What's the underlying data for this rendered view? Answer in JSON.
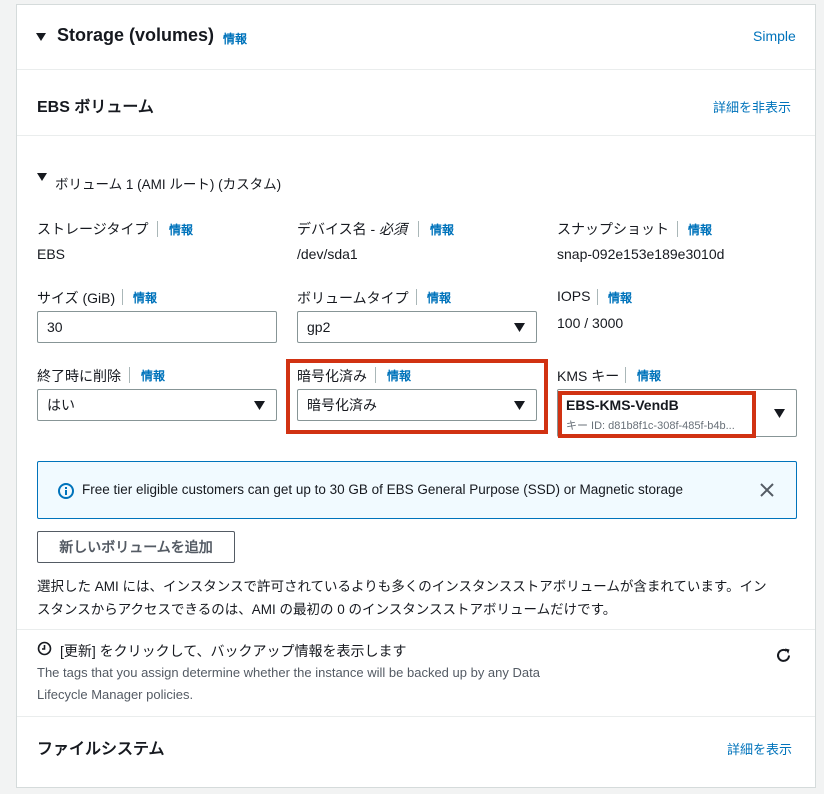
{
  "header": {
    "title": "Storage (volumes)",
    "info": "情報",
    "simple_link": "Simple"
  },
  "ebs": {
    "title": "EBS ボリューム",
    "hide_details": "詳細を非表示"
  },
  "volume": {
    "title": "ボリューム 1 (AMI ルート) (カスタム)",
    "storage_type": {
      "label": "ストレージタイプ",
      "info": "情報",
      "value": "EBS"
    },
    "device_name": {
      "label": "デバイス名 - ",
      "required": "必須",
      "info": "情報",
      "value": "/dev/sda1"
    },
    "snapshot": {
      "label": "スナップショット",
      "info": "情報",
      "value": "snap-092e153e189e3010d"
    },
    "size": {
      "label": "サイズ (GiB)",
      "info": "情報",
      "value": "30"
    },
    "volume_type": {
      "label": "ボリュームタイプ",
      "info": "情報",
      "value": "gp2"
    },
    "iops": {
      "label": "IOPS",
      "info": "情報",
      "value": "100 / 3000"
    },
    "delete_on_termination": {
      "label": "終了時に削除",
      "info": "情報",
      "value": "はい"
    },
    "encrypted": {
      "label": "暗号化済み",
      "info": "情報",
      "value": "暗号化済み"
    },
    "kms_key": {
      "label": "KMS キー",
      "info": "情報",
      "name": "EBS-KMS-VendB",
      "key_id": "キー ID: d81b8f1c-308f-485f-b4b..."
    }
  },
  "alert": {
    "text": "Free tier eligible customers can get up to 30 GB of EBS General Purpose (SSD) or Magnetic storage"
  },
  "add_volume_button": "新しいボリュームを追加",
  "ami_note_line1": "選択した AMI には、インスタンスで許可されているよりも多くのインスタンスストアボリュームが含まれています。イン",
  "ami_note_line2": "スタンスからアクセスできるのは、AMI の最初の 0 のインスタンスストアボリュームだけです。",
  "backup": {
    "title": "[更新] をクリックして、バックアップ情報を表示します",
    "desc_line1": "The tags that you assign determine whether the instance will be backed up by any Data",
    "desc_line2": "Lifecycle Manager policies."
  },
  "filesystem": {
    "title": "ファイルシステム",
    "show_details": "詳細を表示"
  },
  "colors": {
    "link": "#0073bb",
    "highlight": "#d13212",
    "alert_bg": "#f1faff"
  }
}
